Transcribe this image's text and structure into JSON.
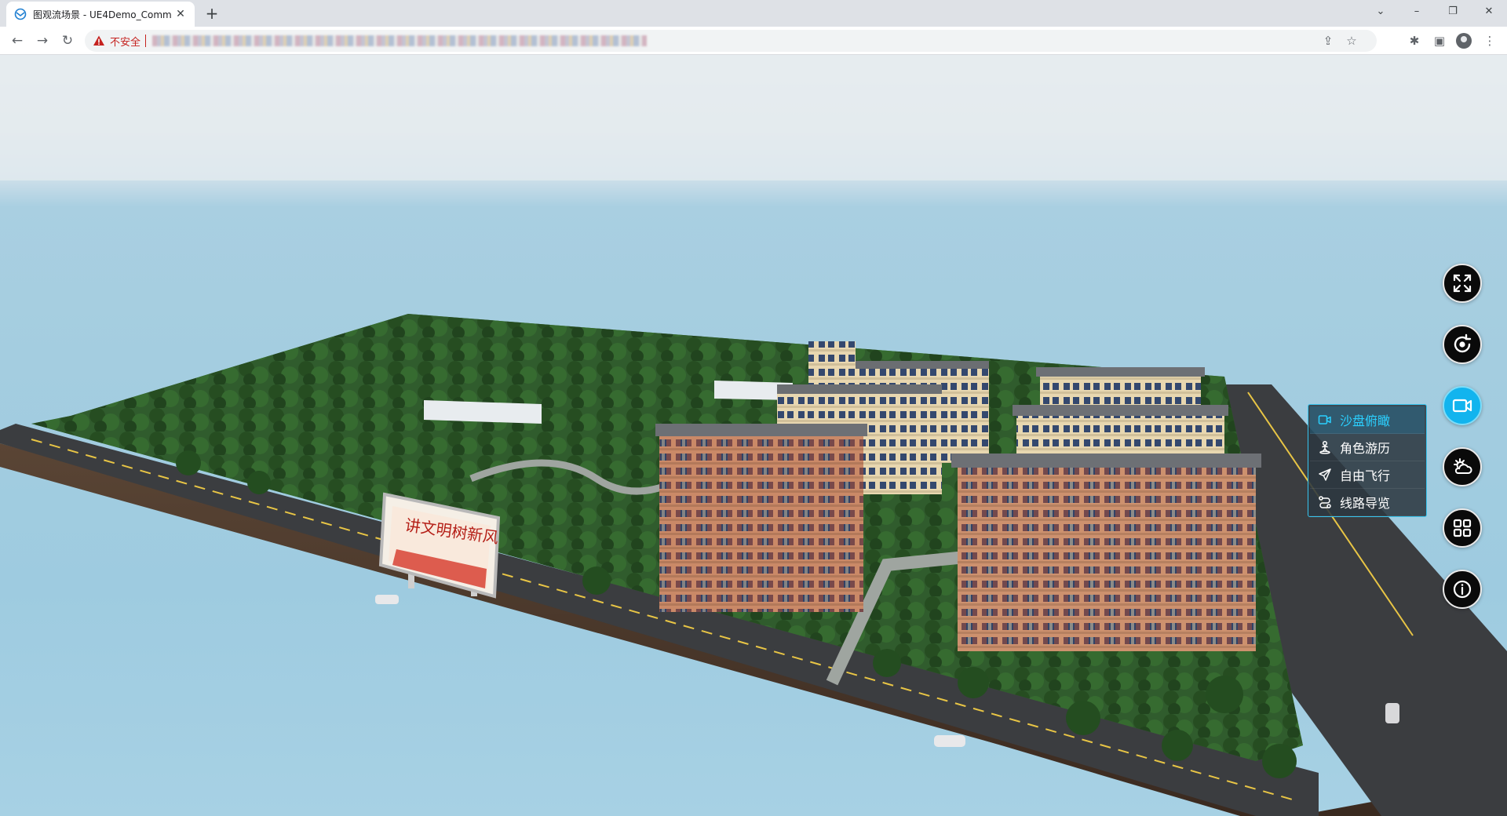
{
  "browser": {
    "tab": {
      "title": "图观流场景 - UE4Demo_Comm",
      "close": "✕"
    },
    "new_tab": "+",
    "window_controls": {
      "list": "⌄",
      "minimize": "–",
      "maximize": "❐",
      "close": "✕"
    },
    "nav": {
      "back": "←",
      "forward": "→",
      "reload": "↻"
    },
    "address": {
      "security_label": "不安全",
      "url": "•••••••••••••••••••••••••••••••••••••••••••••••••••••••••••••••"
    },
    "toolbar_icons": {
      "share": "⇪",
      "bookmark": "☆",
      "extensions": "✱",
      "side_panel": "▣",
      "menu": "⋮"
    }
  },
  "scene": {
    "billboard_text": "讲文明树新风"
  },
  "controls": {
    "buttons": [
      {
        "name": "fullscreen-button",
        "icon": "expand-icon"
      },
      {
        "name": "rotate-button",
        "icon": "rotate-icon"
      },
      {
        "name": "camera-view-button",
        "icon": "video-camera-icon",
        "active": true
      },
      {
        "name": "weather-button",
        "icon": "sun-cloud-icon"
      },
      {
        "name": "layout-button",
        "icon": "grid-icon"
      },
      {
        "name": "info-button",
        "icon": "info-icon"
      }
    ],
    "view_menu": [
      {
        "label": "沙盘俯瞰",
        "icon": "video-camera-icon",
        "active": true
      },
      {
        "label": "角色游历",
        "icon": "person-icon"
      },
      {
        "label": "自由飞行",
        "icon": "paper-plane-icon"
      },
      {
        "label": "线路导览",
        "icon": "route-icon"
      }
    ]
  },
  "colors": {
    "accent": "#12b4ee",
    "menu_active_text": "#2bd0ff",
    "insecure": "#c5221f"
  }
}
